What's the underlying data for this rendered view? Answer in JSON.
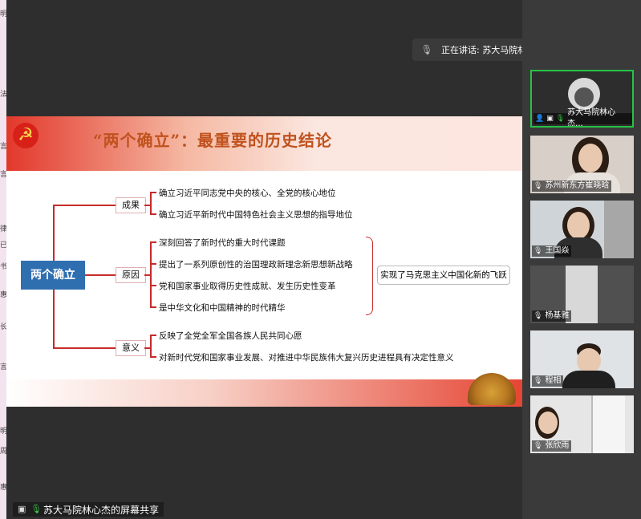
{
  "speaker": {
    "label": "正在讲话: 苏大马院林心杰;"
  },
  "slide": {
    "title": "“两个确立”：最重要的历史结论",
    "main_node": "两个确立",
    "branches": [
      {
        "label": "成果",
        "items": [
          "确立习近平同志党中央的核心、全党的核心地位",
          "确立习近平新时代中国特色社会主义思想的指导地位"
        ]
      },
      {
        "label": "原因",
        "items": [
          "深刻回答了新时代的重大时代课题",
          "提出了一系列原创性的治国理政新理念新思想新战略",
          "党和国家事业取得历史性成就、发生历史性变革",
          "是中华文化和中国精神的时代精华"
        ]
      },
      {
        "label": "意义",
        "items": [
          "反映了全党全军全国各族人民共同心愿",
          "对新时代党和国家事业发展、对推进中华民族伟大复兴历史进程具有决定性意义"
        ]
      }
    ],
    "result": "实现了马克思主义中国化新的飞跃"
  },
  "share_label": "苏大马院林心杰的屏幕共享",
  "participants": [
    {
      "name": "苏大马院林心杰..."
    },
    {
      "name": "苏州新东方崔晓晗"
    },
    {
      "name": "王国焱"
    },
    {
      "name": "杨基雅"
    },
    {
      "name": "程相"
    },
    {
      "name": "张欣雨"
    }
  ],
  "left_strip": [
    "明",
    "法",
    "言",
    "言",
    "律",
    "已",
    "书",
    "惠",
    "长",
    "言",
    "明",
    "周",
    "惠"
  ],
  "colors": {
    "accent": "#2f6fb0",
    "line": "#c62b2b",
    "active": "#27c245"
  }
}
